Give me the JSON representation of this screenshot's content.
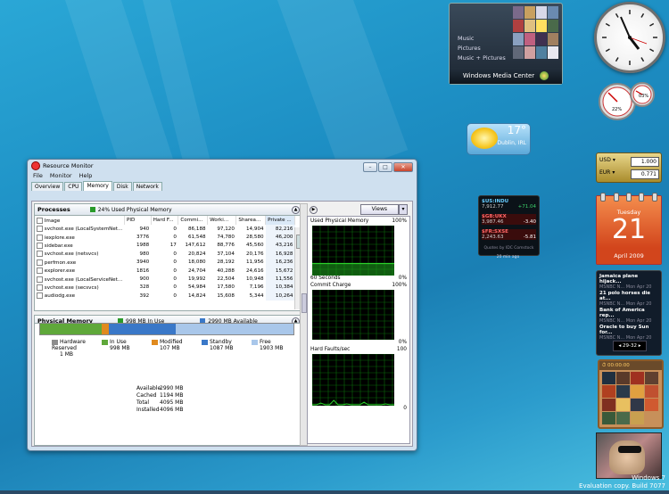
{
  "window": {
    "title": "Resource Monitor",
    "menu": [
      "File",
      "Monitor",
      "Help"
    ],
    "tabs": [
      "Overview",
      "CPU",
      "Memory",
      "Disk",
      "Network"
    ],
    "active_tab": "Memory"
  },
  "processes": {
    "title": "Processes",
    "summary": "24% Used Physical Memory",
    "columns": [
      "Image",
      "PID",
      "Hard F...",
      "Commi...",
      "Worki...",
      "Sharea...",
      "Private ..."
    ],
    "rows": [
      [
        "svchost.exe (LocalSystemNet...",
        "940",
        "0",
        "86,188",
        "97,120",
        "14,904",
        "82,216"
      ],
      [
        "iexplore.exe",
        "3776",
        "0",
        "61,548",
        "74,780",
        "28,580",
        "46,200"
      ],
      [
        "sidebar.exe",
        "1988",
        "17",
        "147,612",
        "88,776",
        "45,560",
        "43,216"
      ],
      [
        "svchost.exe (netsvcs)",
        "980",
        "0",
        "20,824",
        "37,104",
        "20,176",
        "16,928"
      ],
      [
        "perfmon.exe",
        "3940",
        "0",
        "18,080",
        "28,192",
        "11,956",
        "16,236"
      ],
      [
        "explorer.exe",
        "1816",
        "0",
        "24,704",
        "40,288",
        "24,616",
        "15,672"
      ],
      [
        "svchost.exe (LocalServiceNet...",
        "900",
        "0",
        "19,992",
        "22,504",
        "10,948",
        "11,556"
      ],
      [
        "svchost.exe (secsvcs)",
        "328",
        "0",
        "54,984",
        "17,580",
        "7,196",
        "10,384"
      ],
      [
        "audiodg.exe",
        "392",
        "0",
        "14,824",
        "15,608",
        "5,344",
        "10,264"
      ]
    ]
  },
  "physical_memory": {
    "title": "Physical Memory",
    "in_use_label": "998 MB In Use",
    "available_label": "2990 MB Available",
    "bar_segments": [
      {
        "name": "Hardware Reserved",
        "fraction": 0.0002,
        "color": "#8c8c8c"
      },
      {
        "name": "In Use",
        "fraction": 0.2437,
        "color": "#5fa83a"
      },
      {
        "name": "Modified",
        "fraction": 0.0261,
        "color": "#e08a1e"
      },
      {
        "name": "Standby",
        "fraction": 0.2654,
        "color": "#3a78c8"
      },
      {
        "name": "Free",
        "fraction": 0.4646,
        "color": "#a9c7ea"
      }
    ],
    "legend": [
      {
        "name": "Hardware Reserved",
        "value": "1 MB",
        "color": "#8c8c8c"
      },
      {
        "name": "In Use",
        "value": "998 MB",
        "color": "#5fa83a"
      },
      {
        "name": "Modified",
        "value": "107 MB",
        "color": "#e08a1e"
      },
      {
        "name": "Standby",
        "value": "1087 MB",
        "color": "#3a78c8"
      },
      {
        "name": "Free",
        "value": "1903 MB",
        "color": "#a9c7ea"
      }
    ],
    "stats": [
      {
        "k": "Available",
        "v": "2990 MB"
      },
      {
        "k": "Cached",
        "v": "1194 MB"
      },
      {
        "k": "Total",
        "v": "4095 MB"
      },
      {
        "k": "Installed",
        "v": "4096 MB"
      }
    ]
  },
  "graphs": {
    "views_label": "Views",
    "items": [
      {
        "title": "Used Physical Memory",
        "top": "100%",
        "bottom_left": "60 Seconds",
        "bottom_right": "0%",
        "level": 0.24,
        "kind": "flat"
      },
      {
        "title": "Commit Charge",
        "top": "100%",
        "bottom_left": "",
        "bottom_right": "0%",
        "level": 0.0,
        "kind": "none"
      },
      {
        "title": "Hard Faults/sec",
        "top": "100",
        "bottom_left": "",
        "bottom_right": "0",
        "level": 0.05,
        "kind": "spiky"
      }
    ]
  },
  "gadgets": {
    "media_center": {
      "items": [
        "Music",
        "Pictures",
        "Music + Pictures"
      ],
      "footer": "Windows Media Center"
    },
    "weather": {
      "temp": "17°",
      "location": "Dublin, IRL"
    },
    "meter": {
      "cpu": "03%",
      "mem": "22%"
    },
    "currency": [
      {
        "code": "USD",
        "value": "1.000"
      },
      {
        "code": "EUR",
        "value": "0.771"
      }
    ],
    "stocks": {
      "quotes": [
        {
          "sym": "$US:INDU",
          "price": "7,912.77",
          "chg": "+71.04",
          "color": "#3dd36b"
        },
        {
          "sym": "$GB:UKX",
          "price": "3,987.46",
          "chg": "-3.40",
          "color": "#ff5050"
        },
        {
          "sym": "$FR:SXSE",
          "price": "2,243.63",
          "chg": "-5.81",
          "color": "#ff5050"
        }
      ],
      "source": "Quotes by IDC Comstock",
      "age": "20 min ago"
    },
    "calendar": {
      "day": "Tuesday",
      "date": "21",
      "month": "April 2009"
    },
    "feed": {
      "items": [
        {
          "title": "Jamaica plane hijack...",
          "meta": "MSNBC N... Mon Apr 20"
        },
        {
          "title": "21 polo horses die at...",
          "meta": "MSNBC N... Mon Apr 20"
        },
        {
          "title": "Bank of America rep...",
          "meta": "MSNBC N... Mon Apr 20"
        },
        {
          "title": "Oracle to buy Sun for...",
          "meta": "MSNBC N... Mon Apr 20"
        }
      ],
      "pager": "29-32"
    },
    "puzzle": {
      "timer": "00:00:00"
    }
  },
  "watermark": {
    "line1": "Windows 7",
    "line2": "Evaluation copy. Build 7077"
  },
  "colors": {
    "graph_green": "#2bd12b",
    "graph_bg": "#000000",
    "graph_grid": "#0a6b0a"
  }
}
